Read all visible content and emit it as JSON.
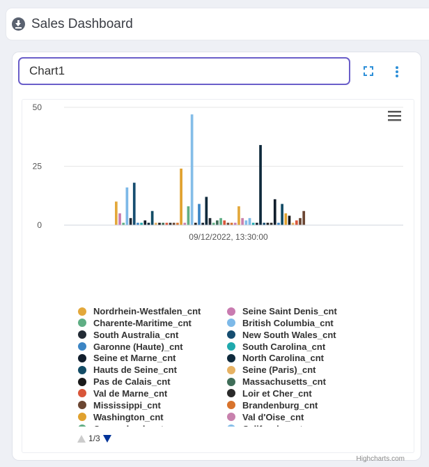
{
  "header": {
    "title": "Sales Dashboard",
    "icon": "download-circle-icon"
  },
  "widget": {
    "title": "Chart1",
    "icons": [
      "fullscreen-icon",
      "more-vertical-icon"
    ]
  },
  "chart_data": {
    "type": "bar",
    "title": "",
    "xlabel": "",
    "ylabel": "",
    "x": [
      "09/12/2022, 13:30:00"
    ],
    "yticks": [
      "0",
      "25",
      "50"
    ],
    "ylim": [
      0,
      50
    ],
    "grid": true,
    "legend": "bottom",
    "series": [
      {
        "name": "Nordrhein-Westfalen_cnt",
        "color": "#e3a83b",
        "value": 10
      },
      {
        "name": "Seine Saint Denis_cnt",
        "color": "#c97bb0",
        "value": 5
      },
      {
        "name": "Charente-Maritime_cnt",
        "color": "#5fae84",
        "value": 1
      },
      {
        "name": "British Columbia_cnt",
        "color": "#7db9e8",
        "value": 16
      },
      {
        "name": "South Australia_cnt",
        "color": "#232b35",
        "value": 3
      },
      {
        "name": "New South Wales_cnt",
        "color": "#164d70",
        "value": 18
      },
      {
        "name": "Garonne (Haute)_cnt",
        "color": "#3c85c4",
        "value": 1
      },
      {
        "name": "South Carolina_cnt",
        "color": "#1fa9ad",
        "value": 1
      },
      {
        "name": "Seine et Marne_cnt",
        "color": "#111e2c",
        "value": 2
      },
      {
        "name": "North Carolina_cnt",
        "color": "#0f2a3c",
        "value": 1
      },
      {
        "name": "Hauts de Seine_cnt",
        "color": "#134c66",
        "value": 6
      },
      {
        "name": "Seine (Paris)_cnt",
        "color": "#e7b263",
        "value": 1
      },
      {
        "name": "Pas de Calais_cnt",
        "color": "#1a1a1a",
        "value": 1
      },
      {
        "name": "Massachusetts_cnt",
        "color": "#3f6d58",
        "value": 1
      },
      {
        "name": "Val de Marne_cnt",
        "color": "#d9563a",
        "value": 1
      },
      {
        "name": "Loir et Cher_cnt",
        "color": "#2a2a2a",
        "value": 1
      },
      {
        "name": "Mississippi_cnt",
        "color": "#6b4632",
        "value": 1
      },
      {
        "name": "Brandenburg_cnt",
        "color": "#d8732c",
        "value": 1
      },
      {
        "name": "Washington_cnt",
        "color": "#e0a12e",
        "value": 24
      },
      {
        "name": "Val d'Oise_cnt",
        "color": "#c881ad",
        "value": 1
      },
      {
        "name": "Queensland_cnt",
        "color": "#60ad84",
        "value": 8
      },
      {
        "name": "California_cnt",
        "color": "#84bde8",
        "value": 47
      }
    ],
    "extra_bar_values": [
      1,
      9,
      1,
      12,
      3,
      1,
      2,
      3,
      2,
      1,
      1,
      1,
      8,
      3,
      2,
      3,
      1,
      1,
      34,
      1,
      1,
      1,
      11,
      1,
      9,
      5,
      4,
      1,
      2,
      3,
      6
    ],
    "extra_bar_colors": [
      "#1a1a1a",
      "#3c85c4",
      "#111e2c",
      "#0f2a3c",
      "#232b35",
      "#5fae84",
      "#3f6d58",
      "#5fae84",
      "#d9563a",
      "#6b4632",
      "#d8732c",
      "#c97bb0",
      "#e3a83b",
      "#c881ad",
      "#84bde8",
      "#7db9e8",
      "#1fa9ad",
      "#111e2c",
      "#0f2a3c",
      "#164d70",
      "#1a1a1a",
      "#2a2a2a",
      "#111e2c",
      "#3c85c4",
      "#134c66",
      "#e0a12e",
      "#1a1a1a",
      "#e7b263",
      "#d9563a",
      "#6b4632",
      "#6b4632"
    ]
  },
  "legend_pager": {
    "current": "1",
    "sep": "/",
    "total": "3"
  },
  "credits": "Highcharts.com"
}
